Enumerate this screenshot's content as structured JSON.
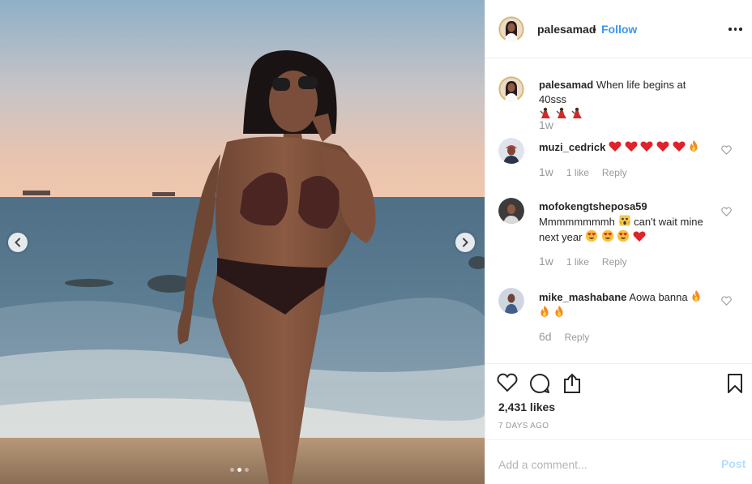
{
  "post": {
    "username": "palesamad",
    "separator": "•",
    "follow_label": "Follow",
    "caption": "When life begins at 40sss",
    "caption_time": "1w",
    "likes": "2,431 likes",
    "age": "7 DAYS AGO",
    "slide_count": 3,
    "active_slide": 2
  },
  "comments": [
    {
      "username": "muzi_cedrick",
      "text": "",
      "emoji": [
        "red-heart",
        "red-heart",
        "red-heart",
        "red-heart",
        "red-heart",
        "fire"
      ],
      "time": "1w",
      "likes": "1 like",
      "reply": "Reply"
    },
    {
      "username": "mofokengtsheposa59",
      "text": "Mmmmmmmmh",
      "text2": "can't wait mine next year",
      "time": "1w",
      "likes": "1 like",
      "reply": "Reply"
    },
    {
      "username": "mike_mashabane",
      "text": "Aowa banna",
      "time": "6d",
      "likes": "",
      "reply": "Reply"
    }
  ],
  "add_comment": {
    "placeholder": "Add a comment...",
    "post_label": "Post"
  },
  "colors": {
    "link_blue": "#3897f0",
    "post_disabled": "#b2dffc",
    "muted": "#999999",
    "border": "#efefef"
  },
  "icons": [
    "chevron-left-icon",
    "chevron-right-icon",
    "more-icon",
    "heart-icon",
    "comment-icon",
    "share-icon",
    "bookmark-icon",
    "small-heart-icon",
    "red-heart-emoji",
    "fire-emoji",
    "dancer-emoji",
    "heart-eyes-emoji",
    "scream-emoji"
  ]
}
